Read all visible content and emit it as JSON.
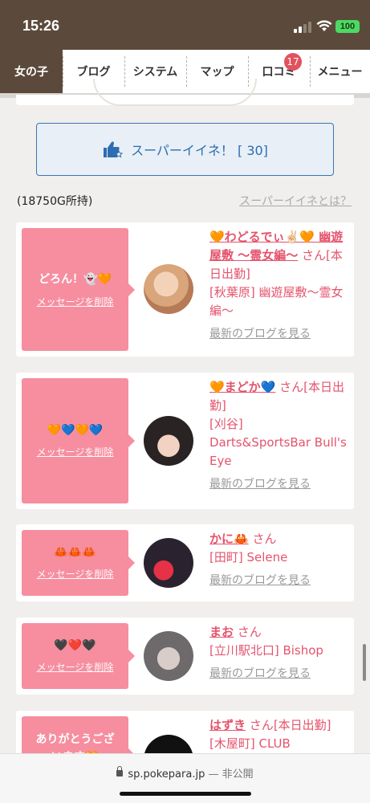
{
  "status": {
    "time": "15:26",
    "battery": "100"
  },
  "nav": {
    "items": [
      {
        "label": "女の子"
      },
      {
        "label": "ブログ"
      },
      {
        "label": "システム"
      },
      {
        "label": "マップ"
      },
      {
        "label": "口コミ",
        "badge": "17"
      },
      {
        "label": "メニュー"
      }
    ]
  },
  "super": {
    "label": "スーパーイイネ！ [ 30]"
  },
  "points": "(18750G所持)",
  "what_link": "スーパーイイネとは？",
  "common": {
    "delete": "メッセージを削除",
    "san": "さん",
    "blog": "最新のブログを見る"
  },
  "cards": [
    {
      "message": "どろん！👻🧡",
      "name": "🧡わどるでぃ✌🏻🧡 幽遊屋敷 〜霊女編〜",
      "extra": "[本日出勤]",
      "shop": "[秋葉原] 幽遊屋敷〜霊女編〜"
    },
    {
      "message": "🧡💙🧡💙",
      "name": "🧡まどか💙",
      "extra": "[本日出勤]",
      "shop": "[刈谷] Darts&SportsBar Bull's Eye"
    },
    {
      "message": "🦀🦀🦀",
      "name": "かに🦀",
      "extra": "",
      "shop": "[田町] Selene"
    },
    {
      "message": "🖤❤️🖤",
      "name": "まお",
      "extra": "",
      "shop": "[立川駅北口] Bishop"
    },
    {
      "message": "ありがとうございます🧡",
      "name": "はずき",
      "extra": "[本日出勤]",
      "shop": "[木屋町] CLUB"
    }
  ],
  "url": "sp.pokepara.jp",
  "url_private": "— 非公開",
  "colors": {
    "brown": "#5b4a3b",
    "pink": "#f68ea0",
    "accent": "#e5536c",
    "blue": "#2d6db3"
  }
}
